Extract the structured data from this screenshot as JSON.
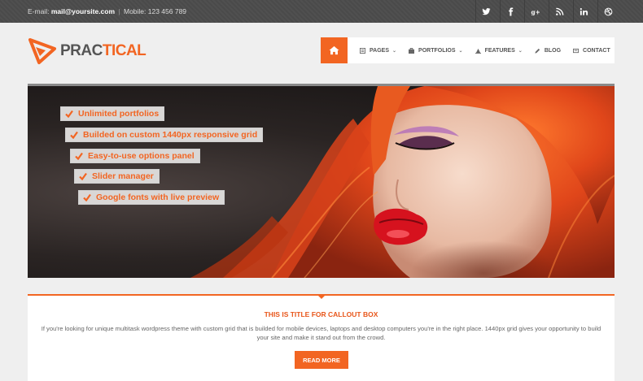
{
  "topbar": {
    "email_label": "E-mail:",
    "email": "mail@yoursite.com",
    "separator": "|",
    "mobile": "Mobile: 123 456 789"
  },
  "social": [
    {
      "name": "twitter-icon",
      "glyph": "t"
    },
    {
      "name": "facebook-icon",
      "glyph": "f"
    },
    {
      "name": "google-plus-icon",
      "glyph": "g+"
    },
    {
      "name": "rss-icon",
      "glyph": "rss"
    },
    {
      "name": "linkedin-icon",
      "glyph": "in"
    },
    {
      "name": "dribbble-icon",
      "glyph": "dribbble"
    }
  ],
  "logo": {
    "part1": "PRAC",
    "part2": "TICAL"
  },
  "nav": {
    "home_icon": "home-icon",
    "items": [
      {
        "label": "Pages",
        "icon": "page-icon",
        "dropdown": true
      },
      {
        "label": "Portfolios",
        "icon": "portfolio-icon",
        "dropdown": true
      },
      {
        "label": "Features",
        "icon": "features-icon",
        "dropdown": true
      },
      {
        "label": "Blog",
        "icon": "pencil-icon",
        "dropdown": false
      },
      {
        "label": "Contact",
        "icon": "contact-icon",
        "dropdown": false
      }
    ],
    "caret": "⌄"
  },
  "hero": {
    "features": [
      "Unlimited portfolios",
      "Builded on custom 1440px responsive grid",
      "Easy-to-use options panel",
      "Slider manager",
      "Google fonts with live preview"
    ]
  },
  "callout": {
    "title": "THIS IS TITLE FOR CALLOUT BOX",
    "text": "If you're looking for unique multitask wordpress theme with custom grid that is builded for mobile devices, laptops and desktop computers you're in the right place. 1440px grid gives your opportunity to build your site and make it stand out from the crowd.",
    "button": "READ MORE"
  },
  "colors": {
    "accent": "#f26522",
    "topbar": "#4a4a4a",
    "background": "#efefef"
  }
}
